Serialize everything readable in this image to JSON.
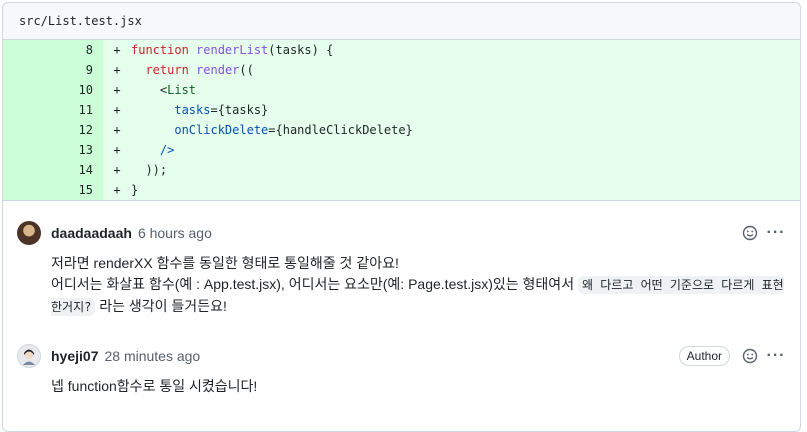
{
  "file": {
    "path": "src/List.test.jsx"
  },
  "diff_lines": [
    {
      "num": "8",
      "sign": "+",
      "parts": [
        {
          "t": "function",
          "c": "kw"
        },
        {
          "t": " ",
          "c": "pl"
        },
        {
          "t": "renderList",
          "c": "fn"
        },
        {
          "t": "(tasks) {",
          "c": "pl"
        }
      ]
    },
    {
      "num": "9",
      "sign": "+",
      "parts": [
        {
          "t": "  ",
          "c": "pl"
        },
        {
          "t": "return",
          "c": "kw"
        },
        {
          "t": " ",
          "c": "pl"
        },
        {
          "t": "render",
          "c": "fn"
        },
        {
          "t": "((",
          "c": "pl"
        }
      ]
    },
    {
      "num": "10",
      "sign": "+",
      "parts": [
        {
          "t": "    <",
          "c": "pl"
        },
        {
          "t": "List",
          "c": "tag"
        }
      ]
    },
    {
      "num": "11",
      "sign": "+",
      "parts": [
        {
          "t": "      ",
          "c": "pl"
        },
        {
          "t": "tasks",
          "c": "attr"
        },
        {
          "t": "={tasks}",
          "c": "pl"
        }
      ]
    },
    {
      "num": "12",
      "sign": "+",
      "parts": [
        {
          "t": "      ",
          "c": "pl"
        },
        {
          "t": "onClickDelete",
          "c": "attr"
        },
        {
          "t": "={handleClickDelete}",
          "c": "pl"
        }
      ]
    },
    {
      "num": "13",
      "sign": "+",
      "parts": [
        {
          "t": "    />",
          "c": "attr"
        }
      ]
    },
    {
      "num": "14",
      "sign": "+",
      "parts": [
        {
          "t": "  ));",
          "c": "pl"
        }
      ]
    },
    {
      "num": "15",
      "sign": "+",
      "parts": [
        {
          "t": "}",
          "c": "pl"
        }
      ]
    }
  ],
  "comments": [
    {
      "author": "daadaadaah",
      "time": "6 hours ago",
      "line1": "저라면 renderXX 함수를 동일한 형태로 통일해줄 것 같아요!",
      "line2_pre": "어디서는 화살표 함수(예 : App.test.jsx), 어디서는 요소만(예: Page.test.jsx)있는 형태여서 ",
      "line2_code": "왜 다르고 어떤 기준으로 다르게 표현한거지?",
      "line2_post": " 라는 생각이 들거든요!"
    },
    {
      "author": "hyeji07",
      "time": "28 minutes ago",
      "badge": "Author",
      "body": "넵 function함수로 통일 시켰습니다!"
    }
  ],
  "icons": {
    "emoji": "smiley-icon",
    "more": "kebab-horizontal-icon"
  },
  "colors": {
    "added_bg": "#e6ffec",
    "added_num_bg": "#ccffd8",
    "keyword": "#cf222e",
    "function": "#8250df"
  }
}
